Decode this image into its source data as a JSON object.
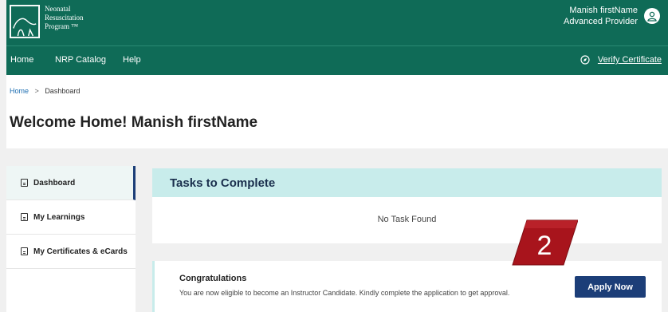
{
  "header": {
    "logo_lines": [
      "Neonatal",
      "Resuscitation",
      "Program ™"
    ],
    "user_name": "Manish firstName",
    "user_role": "Advanced Provider"
  },
  "nav": {
    "items": [
      "Home",
      "NRP Catalog",
      "Help"
    ],
    "verify_label": "Verify Certificate"
  },
  "breadcrumb": {
    "home": "Home",
    "separator": ">",
    "current": "Dashboard"
  },
  "page_title": "Welcome Home! Manish firstName",
  "sidebar": {
    "items": [
      {
        "label": "Dashboard",
        "active": true
      },
      {
        "label": "My Learnings",
        "active": false
      },
      {
        "label": "My Certificates & eCards",
        "active": false
      }
    ]
  },
  "tasks": {
    "title": "Tasks to Complete",
    "empty_text": "No Task Found"
  },
  "congrats": {
    "title": "Congratulations",
    "message": "You are now eligible to become an Instructor Candidate. Kindly complete the application to get approval.",
    "button_label": "Apply Now"
  },
  "step_badge": "2",
  "colors": {
    "brand_green": "#0f6b57",
    "primary_blue": "#1c3e78",
    "tasks_header_bg": "#c8eceb",
    "badge_red": "#a8141c"
  }
}
